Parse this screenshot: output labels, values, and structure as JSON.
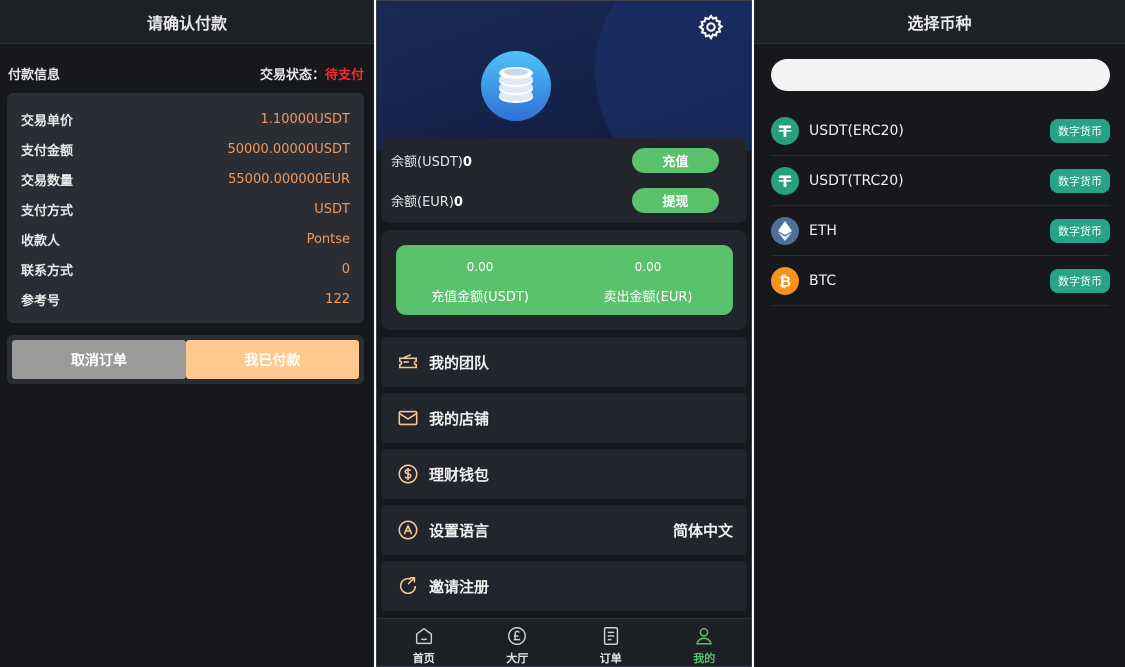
{
  "confirm": {
    "title": "请确认付款",
    "section_label": "付款信息",
    "status_label": "交易状态：",
    "status_value": "待支付",
    "rows": [
      {
        "k": "交易单价",
        "v": "1.10000USDT"
      },
      {
        "k": "支付金额",
        "v": "50000.00000USDT"
      },
      {
        "k": "交易数量",
        "v": "55000.000000EUR"
      },
      {
        "k": "支付方式",
        "v": "USDT"
      },
      {
        "k": "收款人",
        "v": "Pontse"
      },
      {
        "k": "联系方式",
        "v": "0"
      },
      {
        "k": "参考号",
        "v": "122"
      }
    ],
    "cancel_label": "取消订单",
    "paid_label": "我已付款"
  },
  "profile": {
    "balance_usdt_label": "余额(USDT)",
    "balance_usdt_value": "0",
    "balance_eur_label": "余额(EUR)",
    "balance_eur_value": "0",
    "recharge_label": "充值",
    "withdraw_label": "提现",
    "stat_recharge_value": "0.00",
    "stat_recharge_label": "充值金额(USDT)",
    "stat_sell_value": "0.00",
    "stat_sell_label": "卖出金额(EUR)",
    "menu": [
      {
        "label": "我的团队",
        "icon": "team-icon"
      },
      {
        "label": "我的店铺",
        "icon": "shop-icon"
      },
      {
        "label": "理财钱包",
        "icon": "wallet-icon"
      },
      {
        "label": "设置语言",
        "icon": "language-icon",
        "value": "简体中文"
      },
      {
        "label": "邀请注册",
        "icon": "invite-icon"
      }
    ],
    "tabs": [
      {
        "label": "首页",
        "icon": "home-icon"
      },
      {
        "label": "大厅",
        "icon": "hall-icon"
      },
      {
        "label": "订单",
        "icon": "order-icon"
      },
      {
        "label": "我的",
        "icon": "user-icon",
        "active": true
      }
    ],
    "accent": "#5ac26c"
  },
  "select_coin": {
    "title": "选择币种",
    "search_placeholder": "",
    "coins": [
      {
        "name": "USDT(ERC20)",
        "badge": "数字货币",
        "icon": "tether-icon",
        "color": "#26a17b"
      },
      {
        "name": "USDT(TRC20)",
        "badge": "数字货币",
        "icon": "tether-icon",
        "color": "#26a17b"
      },
      {
        "name": "ETH",
        "badge": "数字货币",
        "icon": "ethereum-icon",
        "color": "#627eea"
      },
      {
        "name": "BTC",
        "badge": "数字货币",
        "icon": "bitcoin-icon",
        "color": "#f7931a"
      }
    ]
  }
}
